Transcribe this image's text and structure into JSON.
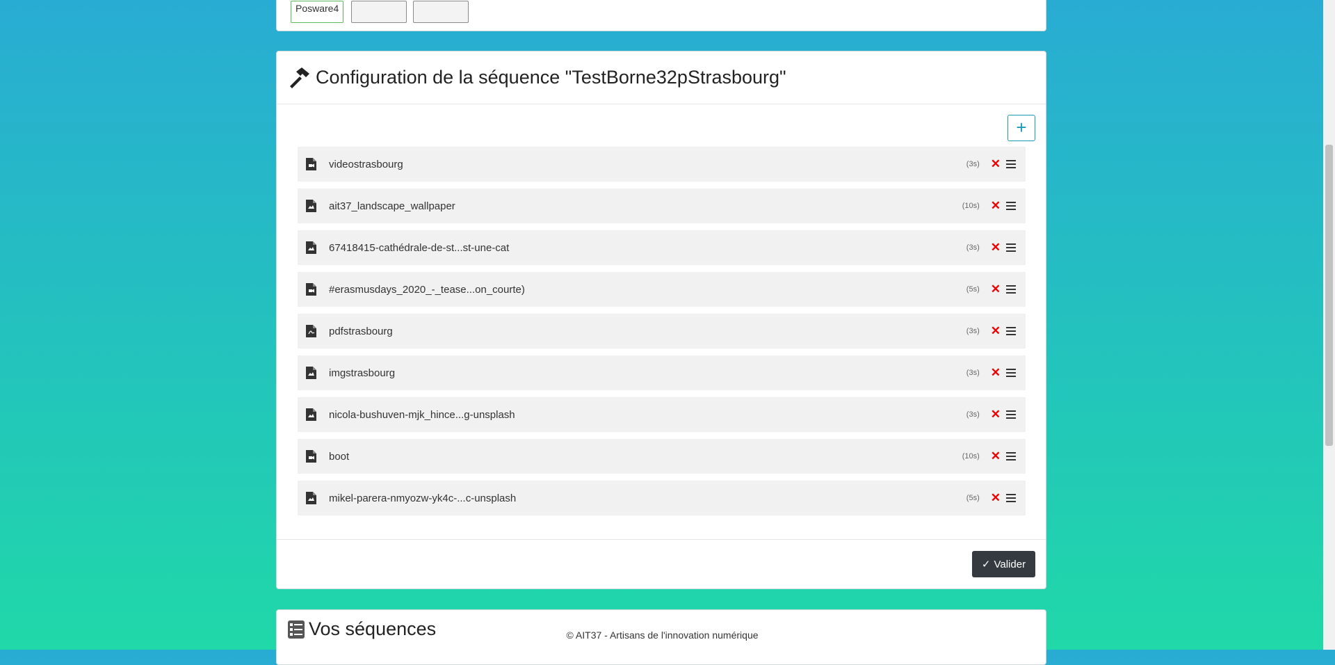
{
  "top_card": {
    "devices": [
      {
        "label": "Posware4",
        "active": true
      },
      {
        "label": "",
        "active": false
      },
      {
        "label": "",
        "active": false
      }
    ]
  },
  "config": {
    "header_icon": "hammer-icon",
    "title": "Configuration de la séquence \"TestBorne32pStrasbourg\"",
    "add_label": "+",
    "items": [
      {
        "name": "videostrasbourg",
        "duration": "(3s)",
        "icon": "file-video-icon"
      },
      {
        "name": "ait37_landscape_wallpaper",
        "duration": "(10s)",
        "icon": "file-image-icon"
      },
      {
        "name": "67418415-cathédrale-de-st...st-une-cat",
        "duration": "(3s)",
        "icon": "file-image-icon"
      },
      {
        "name": "#erasmusdays_2020_-_tease...on_courte)",
        "duration": "(5s)",
        "icon": "file-video-icon"
      },
      {
        "name": "pdfstrasbourg",
        "duration": "(3s)",
        "icon": "file-pdf-icon"
      },
      {
        "name": "imgstrasbourg",
        "duration": "(3s)",
        "icon": "file-image-icon"
      },
      {
        "name": "nicola-bushuven-mjk_hince...g-unsplash",
        "duration": "(3s)",
        "icon": "file-image-icon"
      },
      {
        "name": "boot",
        "duration": "(10s)",
        "icon": "file-video-icon"
      },
      {
        "name": "mikel-parera-nmyozw-yk4c-...c-unsplash",
        "duration": "(5s)",
        "icon": "file-image-icon"
      }
    ],
    "delete_symbol": "✕",
    "valider_label": "Valider",
    "valider_check": "✓"
  },
  "sequences": {
    "icon": "list-icon",
    "title": "Vos séquences"
  },
  "footer": {
    "text": "© AIT37 - Artisans de l'innovation numérique"
  }
}
